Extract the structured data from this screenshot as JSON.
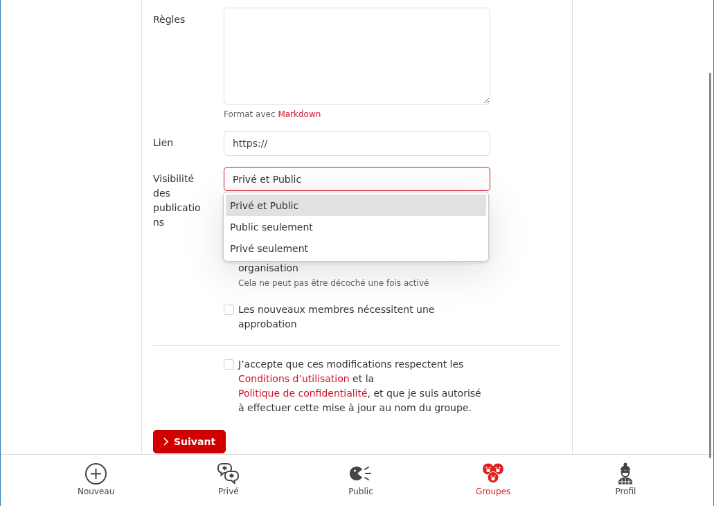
{
  "form": {
    "rules": {
      "label": "Règles",
      "hint": "Format avec",
      "hint_link": "Markdown"
    },
    "link": {
      "label": "Lien",
      "value": "https://"
    },
    "visibility": {
      "label": "Visibilité des publications",
      "value": "Privé et Public",
      "expanded": true,
      "options": [
        {
          "label": "Privé et Public",
          "selected": true
        },
        {
          "label": "Public seulement",
          "selected": false
        },
        {
          "label": "Privé seulement",
          "selected": false
        }
      ]
    },
    "partly_hidden_option": {
      "label": "organisation",
      "hint": "Cela ne peut pas être décoché une fois activé"
    },
    "approval_option": {
      "label": "Les nouveaux membres nécessitent une approbation",
      "checked": false
    },
    "agreement": {
      "checked": false,
      "parts": [
        {
          "kind": "text",
          "text": "J’accepte que ces modifications respectent les "
        },
        {
          "kind": "link",
          "text": "Conditions d’utilisation"
        },
        {
          "kind": "text",
          "text": " et la "
        },
        {
          "kind": "link",
          "text": "Politique de confidentialité"
        },
        {
          "kind": "text",
          "text": ", et que je suis autorisé à effectuer cette mise à jour au nom du groupe."
        }
      ]
    },
    "next_button": {
      "label": "Suivant"
    }
  },
  "bottom_nav": {
    "items": [
      {
        "kind": "new",
        "label": "Nouveau",
        "selected": false
      },
      {
        "kind": "private",
        "label": "Privé",
        "selected": false
      },
      {
        "kind": "public",
        "label": "Public",
        "selected": false
      },
      {
        "kind": "groups",
        "label": "Groupes",
        "selected": true
      },
      {
        "kind": "profile",
        "label": "Profil",
        "selected": false
      }
    ]
  }
}
